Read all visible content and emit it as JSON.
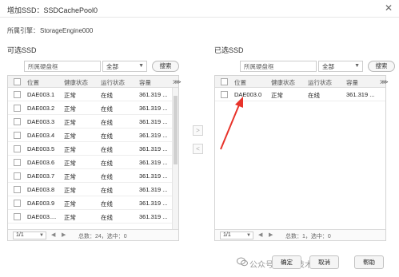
{
  "window": {
    "title": "增加SSD：SSDCachePool0"
  },
  "engine": {
    "label": "所属引擎：",
    "value": "StorageEngine000"
  },
  "columns": {
    "position": "位置",
    "health": "健康状态",
    "running": "运行状态",
    "capacity": "容量",
    "more": "⋙"
  },
  "available": {
    "title": "可选SSD",
    "filter_placeholder": "所属硬盘框",
    "select_value": "全部",
    "search_label": "搜索",
    "rows": [
      {
        "position": "DAE003.1",
        "health": "正常",
        "running": "在线",
        "capacity": "361.319 ..."
      },
      {
        "position": "DAE003.2",
        "health": "正常",
        "running": "在线",
        "capacity": "361.319 ..."
      },
      {
        "position": "DAE003.3",
        "health": "正常",
        "running": "在线",
        "capacity": "361.319 ..."
      },
      {
        "position": "DAE003.4",
        "health": "正常",
        "running": "在线",
        "capacity": "361.319 ..."
      },
      {
        "position": "DAE003.5",
        "health": "正常",
        "running": "在线",
        "capacity": "361.319 ..."
      },
      {
        "position": "DAE003.6",
        "health": "正常",
        "running": "在线",
        "capacity": "361.319 ..."
      },
      {
        "position": "DAE003.7",
        "health": "正常",
        "running": "在线",
        "capacity": "361.319 ..."
      },
      {
        "position": "DAE003.8",
        "health": "正常",
        "running": "在线",
        "capacity": "361.319 ..."
      },
      {
        "position": "DAE003.9",
        "health": "正常",
        "running": "在线",
        "capacity": "361.319 ..."
      },
      {
        "position": "DAE003....",
        "health": "正常",
        "running": "在线",
        "capacity": "361.319 ..."
      }
    ],
    "pager": {
      "page": "1/1",
      "summary": "总数：24，选中：0"
    }
  },
  "selected": {
    "title": "已选SSD",
    "filter_placeholder": "所属硬盘框",
    "select_value": "全部",
    "search_label": "搜索",
    "rows": [
      {
        "position": "DAE003.0",
        "health": "正常",
        "running": "在线",
        "capacity": "361.319 ..."
      }
    ],
    "pager": {
      "page": "1/1",
      "summary": "总数：1，选中：0"
    }
  },
  "transfer": {
    "add": ">",
    "remove": "<"
  },
  "footer": {
    "ok": "确定",
    "cancel": "取消",
    "help": "帮助",
    "watermark": "公众号 · 网络技术干货圈"
  },
  "colors": {
    "annotation_arrow": "#e8332a"
  }
}
